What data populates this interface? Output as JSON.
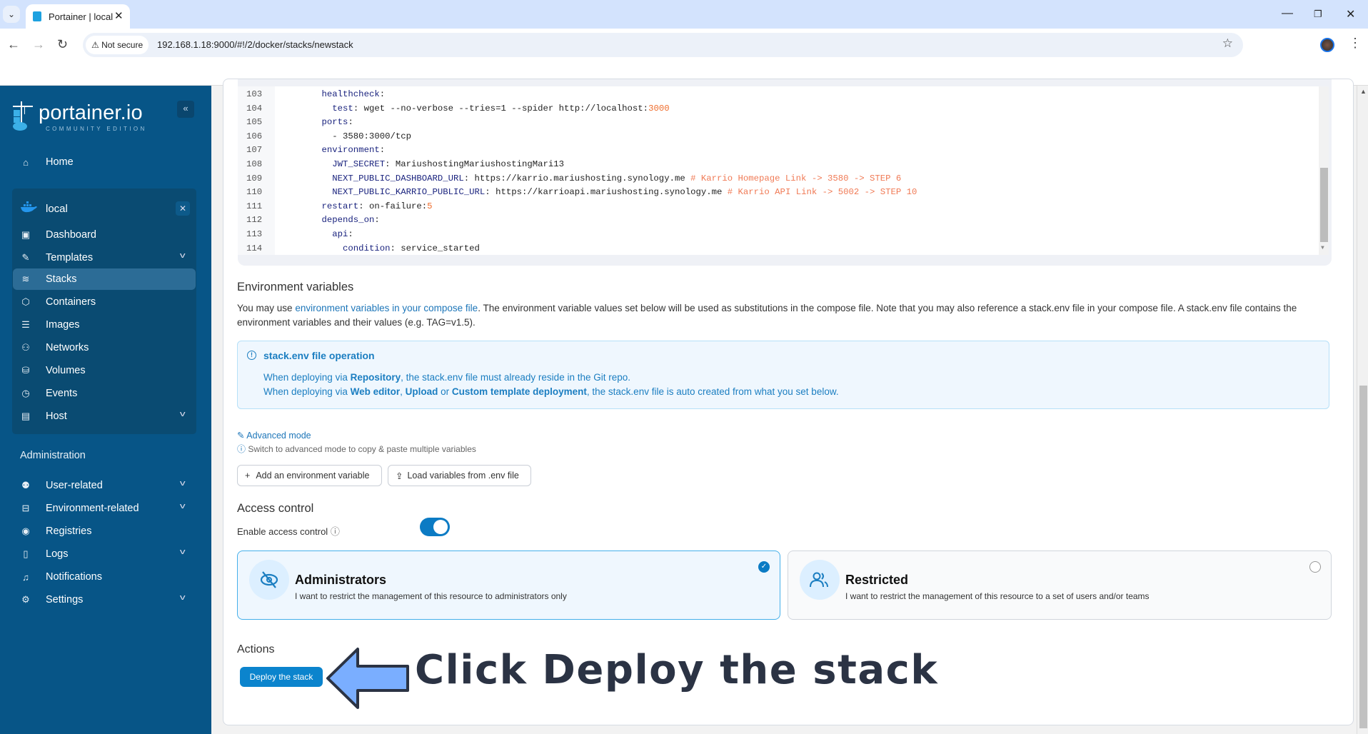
{
  "browser": {
    "tab_title": "Portainer | local",
    "not_secure_label": "Not secure",
    "url": "192.168.1.18:9000/#!/2/docker/stacks/newstack"
  },
  "sidebar": {
    "logo_name": "portainer.io",
    "logo_edition": "COMMUNITY EDITION",
    "home": "Home",
    "environment": "local",
    "env_items": [
      {
        "label": "Dashboard",
        "icon": "dashboard-icon"
      },
      {
        "label": "Templates",
        "icon": "edit-icon",
        "expandable": true
      },
      {
        "label": "Stacks",
        "icon": "layers-icon",
        "active": true
      },
      {
        "label": "Containers",
        "icon": "box-icon"
      },
      {
        "label": "Images",
        "icon": "list-icon"
      },
      {
        "label": "Networks",
        "icon": "network-icon"
      },
      {
        "label": "Volumes",
        "icon": "database-icon"
      },
      {
        "label": "Events",
        "icon": "clock-icon"
      },
      {
        "label": "Host",
        "icon": "host-icon",
        "expandable": true
      }
    ],
    "admin_title": "Administration",
    "admin_items": [
      {
        "label": "User-related",
        "icon": "users-icon",
        "expandable": true
      },
      {
        "label": "Environment-related",
        "icon": "hard-drive-icon",
        "expandable": true
      },
      {
        "label": "Registries",
        "icon": "radio-icon"
      },
      {
        "label": "Logs",
        "icon": "file-text-icon",
        "expandable": true
      },
      {
        "label": "Notifications",
        "icon": "bell-icon"
      },
      {
        "label": "Settings",
        "icon": "gear-icon",
        "expandable": true
      }
    ]
  },
  "editor": {
    "lines": [
      {
        "n": "103",
        "indent": 4,
        "key": "healthcheck",
        "rest": ""
      },
      {
        "n": "104",
        "indent": 6,
        "key": "test",
        "rest": " wget --no-verbose --tries=1 --spider http://localhost:",
        "num": "3000"
      },
      {
        "n": "105",
        "indent": 4,
        "key": "ports",
        "rest": ""
      },
      {
        "n": "106",
        "indent": 6,
        "key": "",
        "rest": "- 3580:3000/tcp"
      },
      {
        "n": "107",
        "indent": 4,
        "key": "environment",
        "rest": ""
      },
      {
        "n": "108",
        "indent": 6,
        "key": "JWT_SECRET",
        "rest": " MariushostingMariushostingMari13"
      },
      {
        "n": "109",
        "indent": 6,
        "key": "NEXT_PUBLIC_DASHBOARD_URL",
        "rest": " https://karrio.mariushosting.synology.me ",
        "comment": "# Karrio Homepage Link -> 3580 -> STEP 6"
      },
      {
        "n": "110",
        "indent": 6,
        "key": "NEXT_PUBLIC_KARRIO_PUBLIC_URL",
        "rest": " https://karrioapi.mariushosting.synology.me ",
        "comment": "# Karrio API Link -> 5002 -> STEP 10"
      },
      {
        "n": "111",
        "indent": 4,
        "key": "restart",
        "rest": " on-failure:",
        "num": "5"
      },
      {
        "n": "112",
        "indent": 4,
        "key": "depends_on",
        "rest": ""
      },
      {
        "n": "113",
        "indent": 6,
        "key": "api",
        "rest": ""
      },
      {
        "n": "114",
        "indent": 8,
        "key": "condition",
        "rest": " service_started"
      }
    ]
  },
  "env_vars": {
    "title": "Environment variables",
    "desc_prefix": "You may use ",
    "desc_link": "environment variables in your compose file",
    "desc_suffix": ". The environment variable values set below will be used as substitutions in the compose file. Note that you may also reference a stack.env file in your compose file. A stack.env file contains the environment variables and their values (e.g. TAG=v1.5).",
    "info_title": "stack.env file operation",
    "info_l1_a": "When deploying via ",
    "info_l1_b": "Repository",
    "info_l1_c": ", the stack.env file must already reside in the Git repo.",
    "info_l2_a": "When deploying via ",
    "info_l2_b": "Web editor",
    "info_l2_c": ", ",
    "info_l2_d": "Upload",
    "info_l2_e": " or ",
    "info_l2_f": "Custom template deployment",
    "info_l2_g": ", the stack.env file is auto created from what you set below.",
    "advanced_mode": "Advanced mode",
    "advanced_hint": "Switch to advanced mode to copy & paste multiple variables",
    "add_button": "Add an environment variable",
    "load_button": "Load variables from .env file"
  },
  "access": {
    "title": "Access control",
    "enable_label": "Enable access control",
    "enabled": true,
    "options": [
      {
        "title": "Administrators",
        "desc": "I want to restrict the management of this resource to administrators only",
        "selected": true
      },
      {
        "title": "Restricted",
        "desc": "I want to restrict the management of this resource to a set of users and/or teams",
        "selected": false
      }
    ]
  },
  "actions": {
    "title": "Actions",
    "deploy_button": "Deploy the stack"
  },
  "annotation": "Click Deploy the stack",
  "colors": {
    "sidebar": "#075587",
    "accent": "#0b84cd",
    "annotation_arrow": "#7aaeff"
  }
}
